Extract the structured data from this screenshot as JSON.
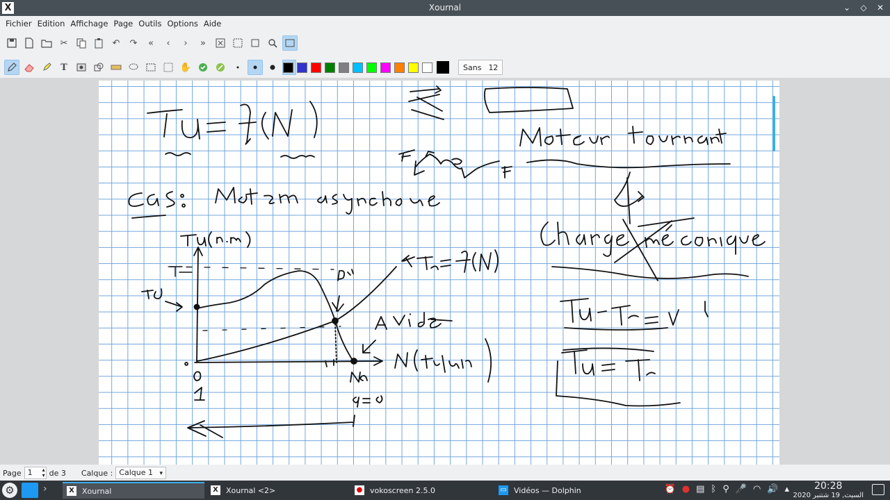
{
  "window": {
    "title": "Xournal"
  },
  "menu": [
    "Fichier",
    "Edition",
    "Affichage",
    "Page",
    "Outils",
    "Options",
    "Aide"
  ],
  "toolbar": {
    "font_name": "Sans",
    "font_size": "12",
    "colors": [
      "#000000",
      "#3333cc",
      "#ff0000",
      "#008000",
      "#808080",
      "#00c0ff",
      "#00ff00",
      "#ff00ff",
      "#ff8000",
      "#ffff00",
      "#ffffff"
    ],
    "current_color": "#000000"
  },
  "statusbar": {
    "page_label": "Page",
    "page_value": "1",
    "page_total": "de 3",
    "layer_label": "Calque :",
    "layer_value": "Calque 1"
  },
  "taskbar": {
    "tasks": [
      "Xournal",
      "Xournal <2>",
      "vokoscreen 2.5.0",
      "Vidéos — Dolphin"
    ],
    "time": "20:28",
    "date": "السبت, 19 شتنبر 2020"
  }
}
